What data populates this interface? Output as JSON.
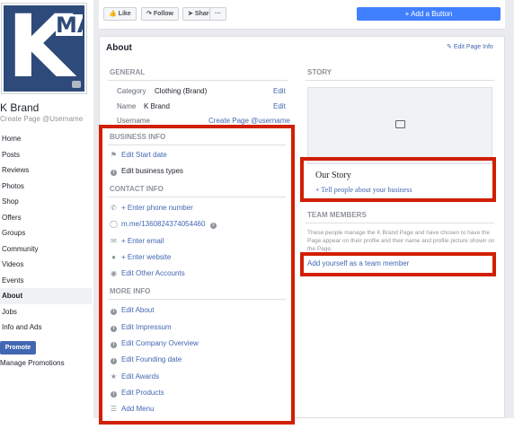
{
  "sidebar": {
    "brand_name": "K Brand",
    "brand_username": "Create Page @Username",
    "logo_letter": "K",
    "logo_side": "MA",
    "items": [
      {
        "label": "Home",
        "active": false
      },
      {
        "label": "Posts",
        "active": false
      },
      {
        "label": "Reviews",
        "active": false
      },
      {
        "label": "Photos",
        "active": false
      },
      {
        "label": "Shop",
        "active": false
      },
      {
        "label": "Offers",
        "active": false
      },
      {
        "label": "Groups",
        "active": false
      },
      {
        "label": "Community",
        "active": false
      },
      {
        "label": "Videos",
        "active": false
      },
      {
        "label": "Events",
        "active": false
      },
      {
        "label": "About",
        "active": true
      },
      {
        "label": "Jobs",
        "active": false
      },
      {
        "label": "Info and Ads",
        "active": false
      }
    ],
    "promote_label": "Promote",
    "manage_promotions": "Manage Promotions"
  },
  "toolbar": {
    "like": "Like",
    "follow": "Follow",
    "share": "Share",
    "more": "···",
    "add_button": "+ Add a Button"
  },
  "about": {
    "title": "About",
    "edit_page_info": "Edit Page Info",
    "general": {
      "heading": "GENERAL",
      "rows": [
        {
          "label": "Category",
          "value": "Clothing (Brand)",
          "action": "Edit"
        },
        {
          "label": "Name",
          "value": "K Brand",
          "action": "Edit"
        },
        {
          "label": "Username",
          "value": "",
          "action": "Create Page @username"
        }
      ]
    },
    "business_info": {
      "heading": "BUSINESS INFO",
      "items": [
        {
          "icon": "flag-icon",
          "text": "Edit Start date"
        },
        {
          "icon": "info-icon",
          "text": "Edit business types"
        }
      ]
    },
    "contact_info": {
      "heading": "CONTACT INFO",
      "items": [
        {
          "icon": "phone-icon",
          "text": "+ Enter phone number"
        },
        {
          "icon": "messenger-icon",
          "text": "m.me/1360824374054460"
        },
        {
          "icon": "email-icon",
          "text": "+ Enter email"
        },
        {
          "icon": "globe-icon",
          "text": "+ Enter website"
        },
        {
          "icon": "accounts-icon",
          "text": "Edit Other Accounts"
        }
      ]
    },
    "more_info": {
      "heading": "MORE INFO",
      "items": [
        {
          "icon": "info-icon",
          "text": "Edit About"
        },
        {
          "icon": "info-icon",
          "text": "Edit Impressum"
        },
        {
          "icon": "info-icon",
          "text": "Edit Company Overview"
        },
        {
          "icon": "info-icon",
          "text": "Edit Founding date"
        },
        {
          "icon": "trophy-icon",
          "text": "Edit Awards"
        },
        {
          "icon": "info-icon",
          "text": "Edit Products"
        },
        {
          "icon": "menu-icon",
          "text": "Add Menu"
        }
      ]
    }
  },
  "story": {
    "heading": "STORY",
    "title": "Our Story",
    "link": "+ Tell people about your business"
  },
  "team": {
    "heading": "TEAM MEMBERS",
    "description": "These people manage the K Brand Page and have chosen to have the Page appear on their profile and their name and profile picture shown on the Page.",
    "add_link": "Add yourself as a team member"
  },
  "colors": {
    "highlight": "#d11f00",
    "link": "#4267b2",
    "button": "#4080ff",
    "brand_blue": "#2e4a7a"
  }
}
